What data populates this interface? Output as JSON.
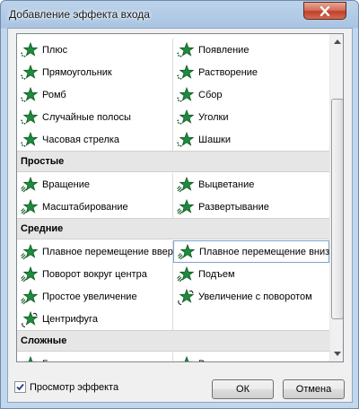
{
  "window": {
    "title": "Добавление эффекта входа"
  },
  "rows": [
    {
      "kind": "item",
      "left": {
        "label": "Плюс",
        "icon": "star-dots-icon"
      },
      "right": {
        "label": "Появление",
        "icon": "star-dots-icon"
      }
    },
    {
      "kind": "item",
      "left": {
        "label": "Прямоугольник",
        "icon": "star-dots-icon"
      },
      "right": {
        "label": "Растворение",
        "icon": "star-dots-icon"
      }
    },
    {
      "kind": "item",
      "left": {
        "label": "Ромб",
        "icon": "star-dots-icon"
      },
      "right": {
        "label": "Сбор",
        "icon": "star-dots-icon"
      }
    },
    {
      "kind": "item",
      "left": {
        "label": "Случайные полосы",
        "icon": "star-dots-icon"
      },
      "right": {
        "label": "Уголки",
        "icon": "star-dots-icon"
      }
    },
    {
      "kind": "item",
      "left": {
        "label": "Часовая стрелка",
        "icon": "star-dots-icon"
      },
      "right": {
        "label": "Шашки",
        "icon": "star-dots-icon"
      }
    },
    {
      "kind": "category",
      "label": "Простые"
    },
    {
      "kind": "item",
      "left": {
        "label": "Вращение",
        "icon": "star-motion-icon"
      },
      "right": {
        "label": "Выцветание",
        "icon": "star-motion-icon"
      }
    },
    {
      "kind": "item",
      "left": {
        "label": "Масштабирование",
        "icon": "star-motion-icon"
      },
      "right": {
        "label": "Развертывание",
        "icon": "star-motion-icon"
      }
    },
    {
      "kind": "category",
      "label": "Средние"
    },
    {
      "kind": "item",
      "left": {
        "label": "Плавное перемещение вверх",
        "icon": "star-motion-icon"
      },
      "right": {
        "label": "Плавное перемещение вниз",
        "icon": "star-motion-icon",
        "selected": true
      }
    },
    {
      "kind": "item",
      "left": {
        "label": "Поворот вокруг центра",
        "icon": "star-motion-icon"
      },
      "right": {
        "label": "Подъем",
        "icon": "star-motion-icon"
      }
    },
    {
      "kind": "item",
      "left": {
        "label": "Простое увеличение",
        "icon": "star-motion-icon"
      },
      "right": {
        "label": "Увеличение с поворотом",
        "icon": "star-spin-icon"
      }
    },
    {
      "kind": "item",
      "left": {
        "label": "Центрифуга",
        "icon": "star-spin-icon"
      },
      "right": null
    },
    {
      "kind": "category",
      "label": "Сложные"
    },
    {
      "kind": "item",
      "left": {
        "label": "Бумеранг",
        "icon": "star-motion-icon"
      },
      "right": {
        "label": "Выскакивание",
        "icon": "star-motion-icon"
      }
    }
  ],
  "footer": {
    "preview_label": "Просмотр эффекта",
    "preview_checked": true,
    "ok_label": "ОК",
    "cancel_label": "Отмена"
  },
  "colors": {
    "star": "#1f8a3e",
    "star_dark": "#0f5a24",
    "selection_border": "#7da2ce"
  }
}
